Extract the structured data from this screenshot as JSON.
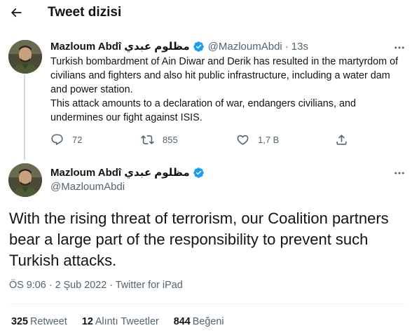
{
  "header": {
    "title": "Tweet dizisi"
  },
  "icons": {
    "back": "arrow-left-icon",
    "verified": "verified-badge-icon",
    "more": "more-horizontal-icon",
    "reply": "reply-icon",
    "retweet": "retweet-icon",
    "like": "heart-icon",
    "share": "share-icon"
  },
  "colors": {
    "verified": "#1d9bf0",
    "text": "#0f1419",
    "muted": "#536471",
    "line": "#cfd9de"
  },
  "parent_tweet": {
    "name": "Mazloum Abdî مظلوم عبدي",
    "handle": "@MazloumAbdi",
    "separator": "·",
    "time": "13s",
    "text_p1": "Turkish bombardment of Ain Diwar and Derik has resulted in the martyrdom of civilians and fighters and also hit public infrastructure, including a water dam and power station.",
    "text_p2": "This attack amounts to a declaration of war, endangers civilians, and undermines our fight against ISIS.",
    "replies": "72",
    "retweets": "855",
    "likes": "1,7 B"
  },
  "main_tweet": {
    "name": "Mazloum Abdî مظلوم عبدي",
    "handle": "@MazloumAbdi",
    "text": "With the rising threat of terrorism, our Coalition partners bear a large part of the responsibility to prevent such Turkish attacks.",
    "meta": "ÖS 9:06 · 2 Şub 2022 · Twitter for iPad",
    "retweet_count": "325",
    "retweet_label": "Retweet",
    "quote_count": "12",
    "quote_label": "Alıntı Tweetler",
    "like_count": "844",
    "like_label": "Beğeni"
  }
}
